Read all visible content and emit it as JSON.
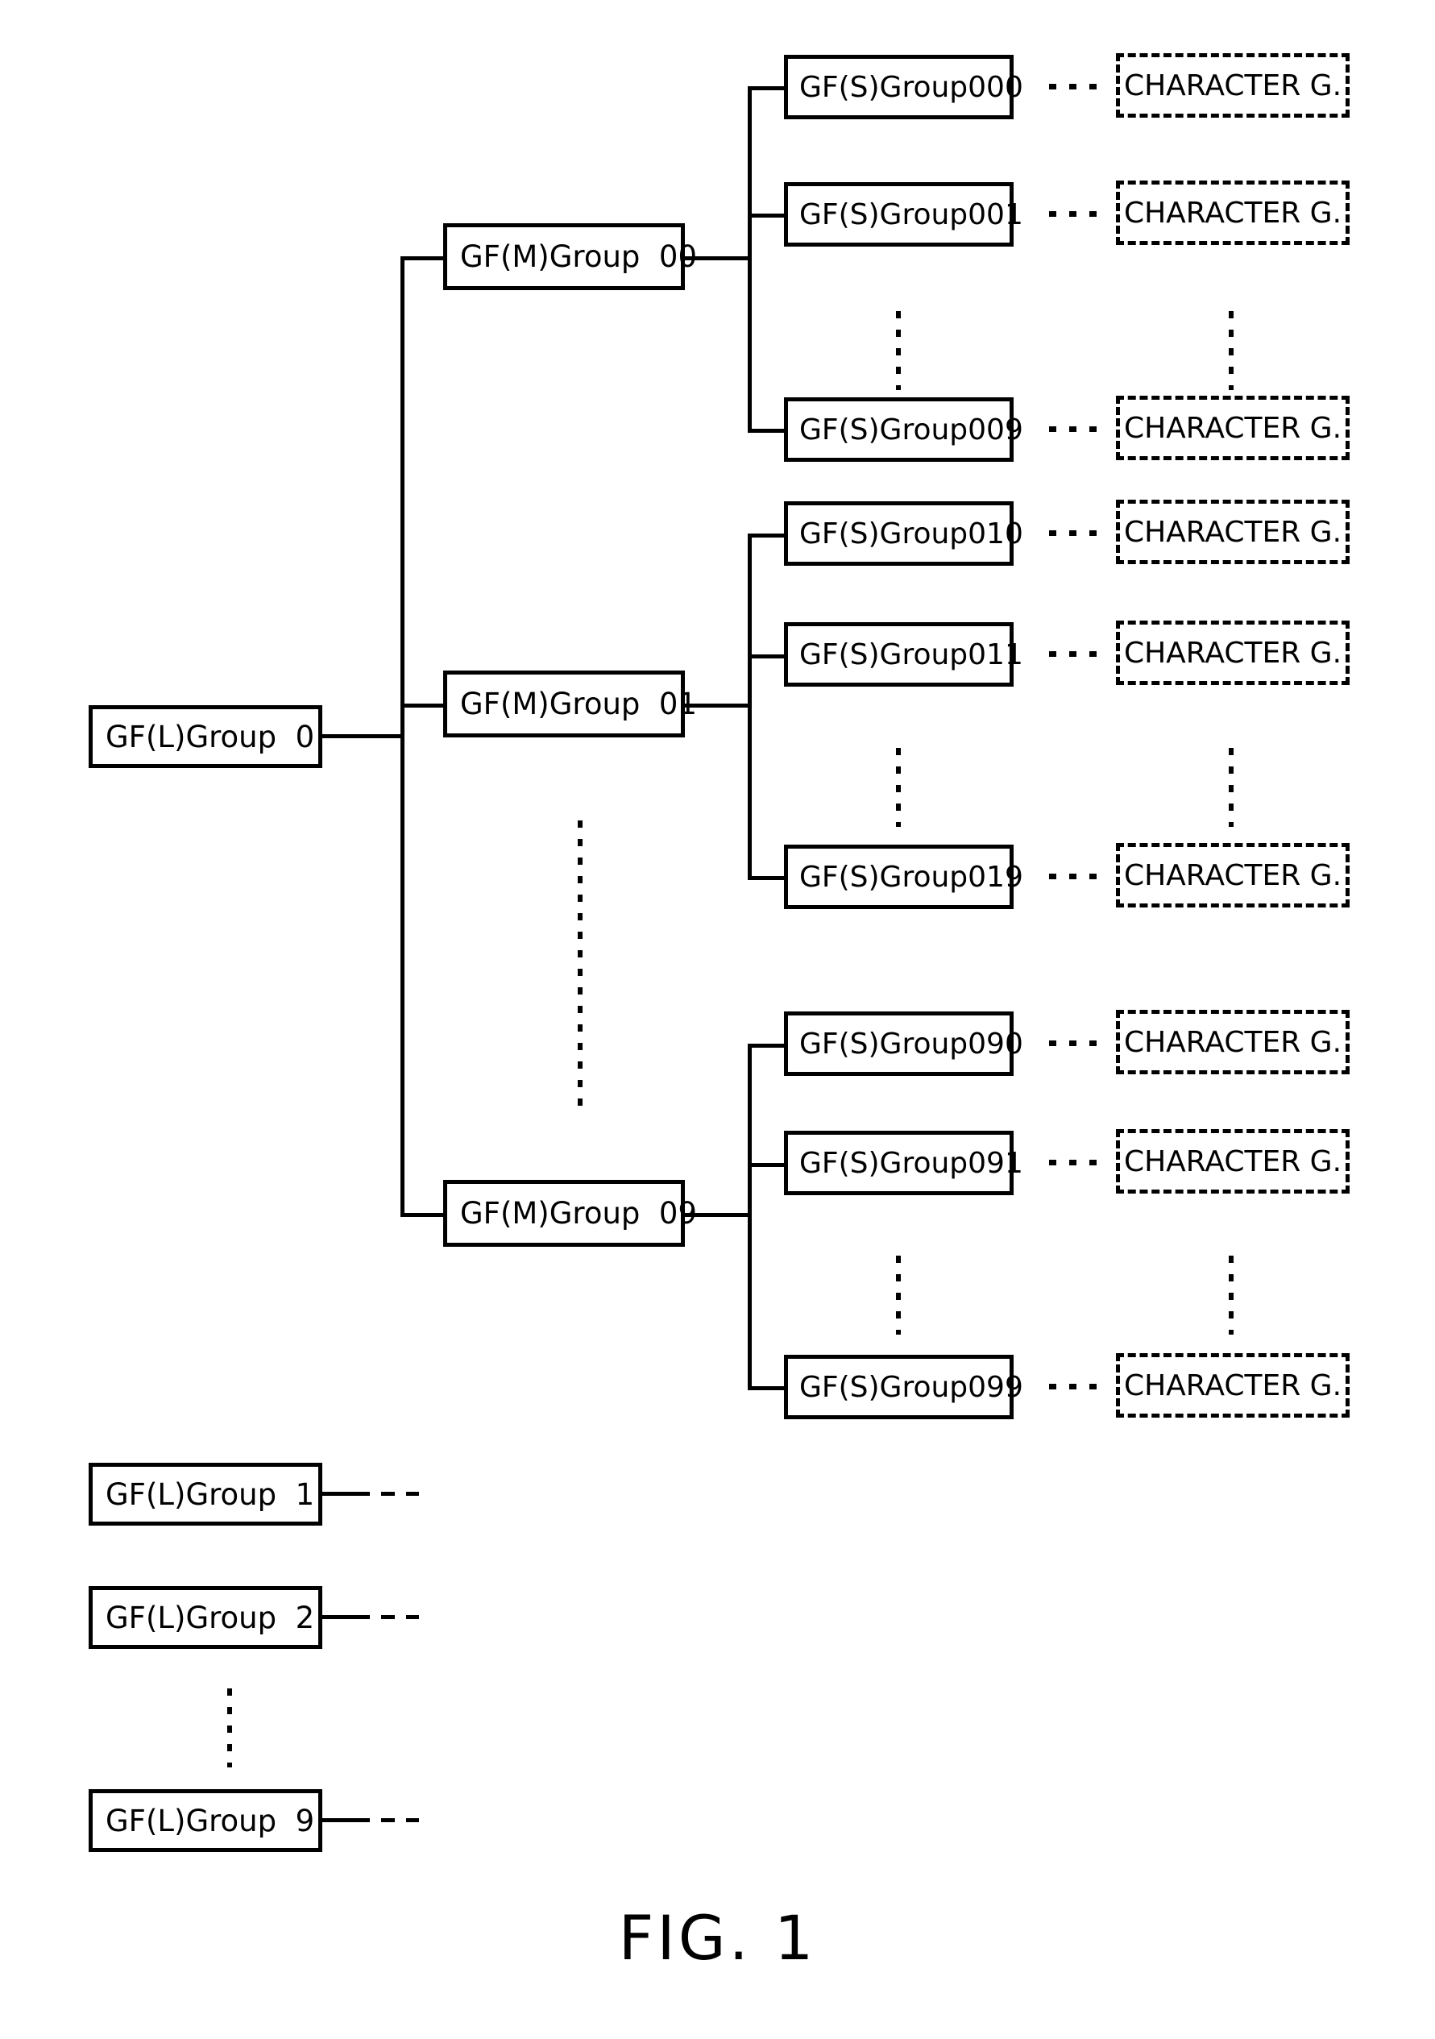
{
  "figure": {
    "caption": "FIG. 1",
    "line_color": "#000000",
    "background": "#ffffff"
  },
  "root": {
    "label": "GF(L)Group  0"
  },
  "medium_groups": [
    {
      "label": "GF(M)Group  00"
    },
    {
      "label": "GF(M)Group  01"
    },
    {
      "label": "GF(M)Group  09"
    }
  ],
  "small_groups": [
    {
      "label": "GF(S)Group000",
      "character": "CHARACTER G."
    },
    {
      "label": "GF(S)Group001",
      "character": "CHARACTER G."
    },
    {
      "label": "GF(S)Group009",
      "character": "CHARACTER G."
    },
    {
      "label": "GF(S)Group010",
      "character": "CHARACTER G."
    },
    {
      "label": "GF(S)Group011",
      "character": "CHARACTER G."
    },
    {
      "label": "GF(S)Group019",
      "character": "CHARACTER G."
    },
    {
      "label": "GF(S)Group090",
      "character": "CHARACTER G."
    },
    {
      "label": "GF(S)Group091",
      "character": "CHARACTER G."
    },
    {
      "label": "GF(S)Group099",
      "character": "CHARACTER G."
    }
  ],
  "other_large_groups": [
    {
      "label": "GF(L)Group  1"
    },
    {
      "label": "GF(L)Group  2"
    },
    {
      "label": "GF(L)Group  9"
    }
  ]
}
